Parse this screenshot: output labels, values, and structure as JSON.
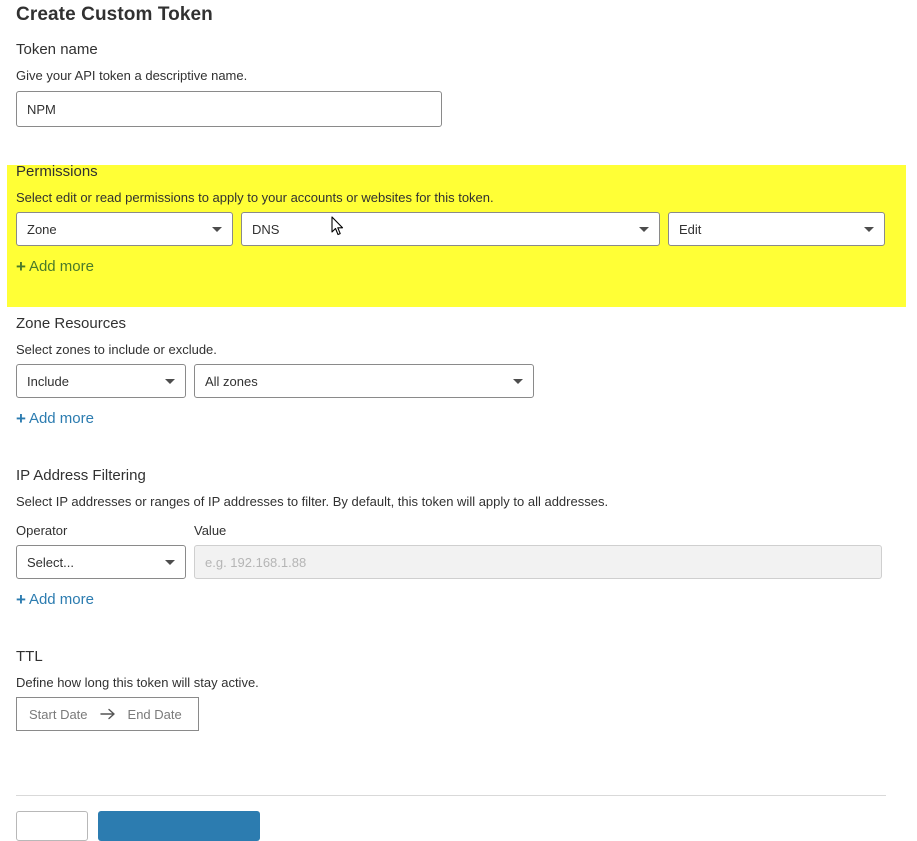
{
  "page": {
    "title": "Create Custom Token"
  },
  "token_name": {
    "label": "Token name",
    "help": "Give your API token a descriptive name.",
    "value": "NPM"
  },
  "permissions": {
    "label": "Permissions",
    "help": "Select edit or read permissions to apply to your accounts or websites for this token.",
    "scope": "Zone",
    "resource": "DNS",
    "access": "Edit",
    "add_more": "Add more"
  },
  "zone_resources": {
    "label": "Zone Resources",
    "help": "Select zones to include or exclude.",
    "mode": "Include",
    "zones": "All zones",
    "add_more": "Add more"
  },
  "ip_filtering": {
    "label": "IP Address Filtering",
    "help": "Select IP addresses or ranges of IP addresses to filter. By default, this token will apply to all addresses.",
    "operator_label": "Operator",
    "value_label": "Value",
    "operator_value": "Select...",
    "value_placeholder": "e.g. 192.168.1.88",
    "add_more": "Add more"
  },
  "ttl": {
    "label": "TTL",
    "help": "Define how long this token will stay active.",
    "start_placeholder": "Start Date",
    "end_placeholder": "End Date"
  },
  "colors": {
    "highlight": "#ffff36",
    "link": "#2c7cb0",
    "text": "#313131"
  },
  "icons": {
    "add": "plus-icon",
    "dropdown": "caret-down-icon",
    "range_arrow": "arrow-right-icon",
    "cursor": "mouse-pointer-icon"
  }
}
